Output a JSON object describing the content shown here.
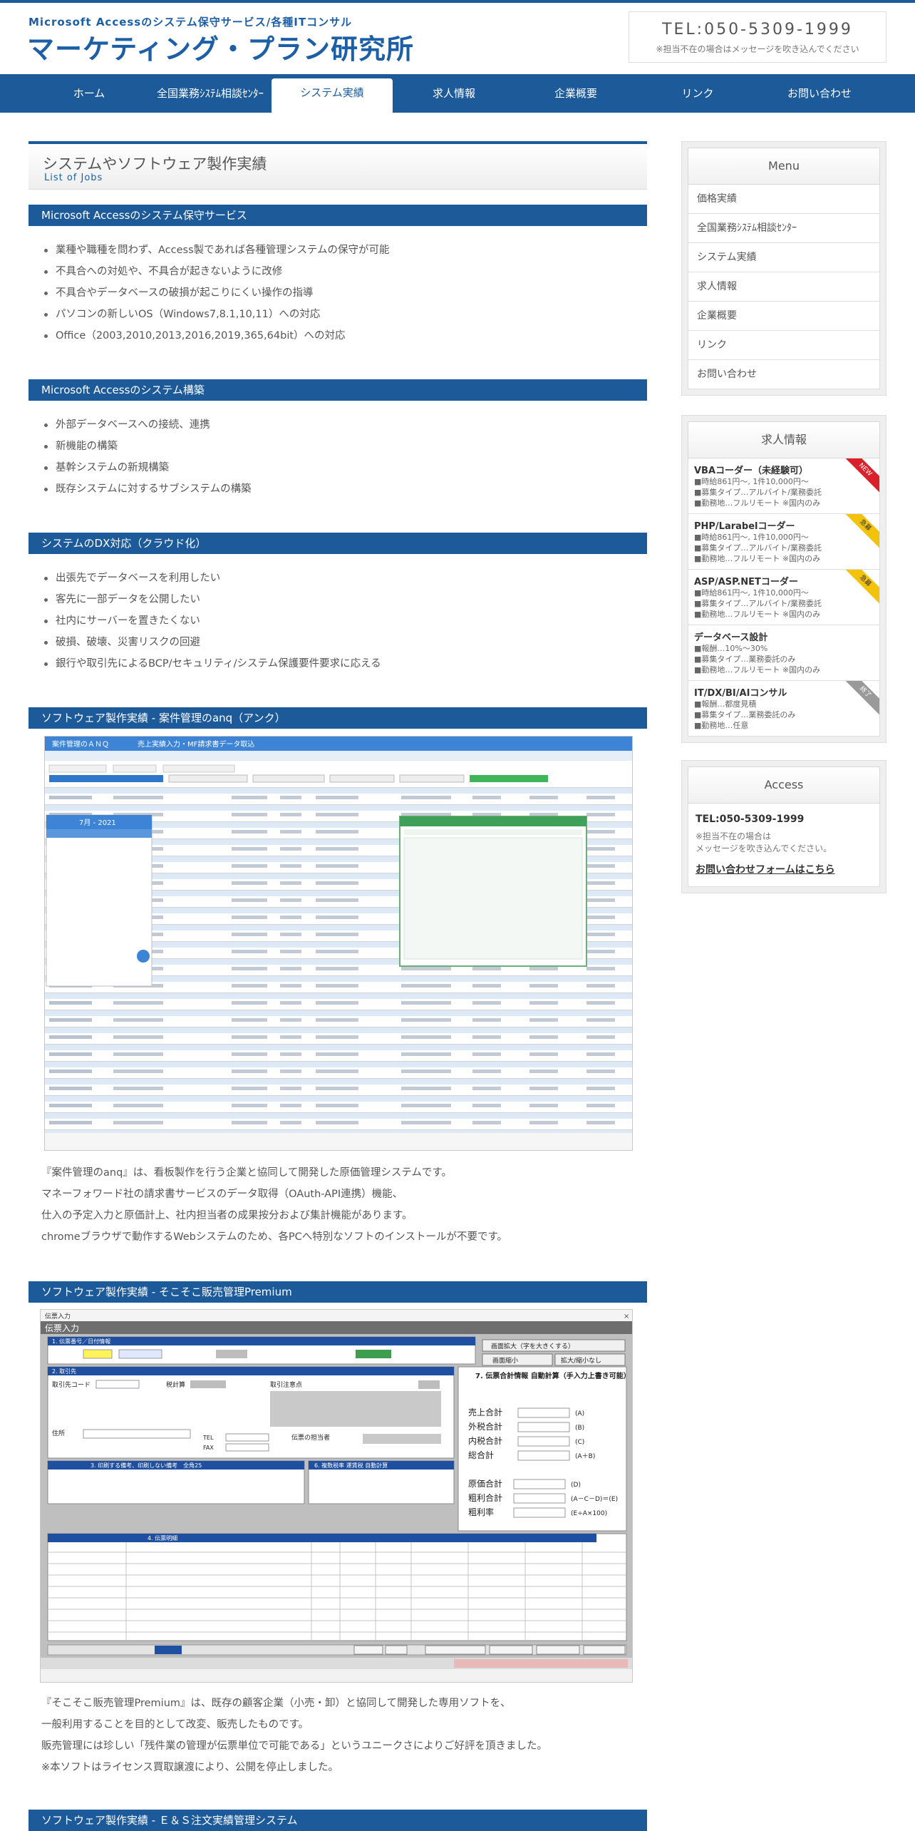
{
  "header": {
    "tagline": "Microsoft Accessのシステム保守サービス/各種ITコンサル",
    "logo": "マーケティング・プラン研究所",
    "tel": "TEL:050-5309-1999",
    "tel_note": "※担当不在の場合はメッセージを吹き込んでください"
  },
  "nav": [
    {
      "label": "ホーム"
    },
    {
      "label": "全国業務ｼｽﾃﾑ相談ｾﾝﾀｰ"
    },
    {
      "label": "システム実績"
    },
    {
      "label": "求人情報"
    },
    {
      "label": "企業概要"
    },
    {
      "label": "リンク"
    },
    {
      "label": "お問い合わせ"
    }
  ],
  "page": {
    "title": "システムやソフトウェア製作実績",
    "subtitle": "List of Jobs"
  },
  "sections": [
    {
      "heading": "Microsoft Accessのシステム保守サービス",
      "items": [
        "業種や職種を問わず、Access製であれば各種管理システムの保守が可能",
        "不具合への対処や、不具合が起きないように改修",
        "不具合やデータベースの破損が起こりにくい操作の指導",
        "パソコンの新しいOS（Windows7,8.1,10,11）への対応",
        "Office（2003,2010,2013,2016,2019,365,64bit）への対応"
      ]
    },
    {
      "heading": "Microsoft Accessのシステム構築",
      "items": [
        "外部データベースへの接続、連携",
        "新機能の構築",
        "基幹システムの新規構築",
        "既存システムに対するサブシステムの構築"
      ]
    },
    {
      "heading": "システムのDX対応（クラウド化）",
      "items": [
        "出張先でデータベースを利用したい",
        "客先に一部データを公開したい",
        "社内にサーバーを置きたくない",
        "破損、破壊、災害リスクの回避",
        "銀行や取引先によるBCP/セキュリティ/システム保護要件要求に応える"
      ]
    },
    {
      "heading": "ソフトウェア製作実績 - 案件管理のanq（アンク）",
      "paragraphs": [
        "『案件管理のanq』は、看板製作を行う企業と協同して開発した原価管理システムです。",
        "マネーフォワード社の請求書サービスのデータ取得（OAuth-API連携）機能、",
        "仕入の予定入力と原価計上、社内担当者の成果按分および集計機能があります。",
        "chromeブラウザで動作するWebシステムのため、各PCへ特別なソフトのインストールが不要です。"
      ]
    },
    {
      "heading": "ソフトウェア製作実績 - そこそこ販売管理Premium",
      "paragraphs": [
        "『そこそこ販売管理Premium』は、既存の顧客企業（小売・卸）と協同して開発した専用ソフトを、",
        "一般利用することを目的として改変、販売したものです。",
        "販売管理には珍しい「残件業の管理が伝票単位で可能である」というユニークさによりご好評を頂きました。",
        "※本ソフトはライセンス買取譲渡により、公開を停止しました。"
      ]
    },
    {
      "heading": "ソフトウェア製作実績 - Ｅ＆Ｓ注文実績管理システム"
    }
  ],
  "anq_shot": {
    "title": "案件管理のＡＮＱ",
    "subtitle": "売上実績入力・MF請求書データ取込",
    "calendar_month": "7月 - 2021"
  },
  "sokoso_shot": {
    "window_title": "伝票入力",
    "header": "伝票入力",
    "panel1": "1. 伝票番号／日付情報",
    "panel2": "2. 取引先",
    "panel3": "3. 印刷する備考、印刷しない備考　全角25",
    "panel6": "6. 複数税率 運賃税 自動計算",
    "panel7": "7. 伝票合計情報 自動計算（手入力上書き可能）",
    "panel4": "4. 伝票明細",
    "totals": [
      {
        "label": "売上合計",
        "code": "(A)"
      },
      {
        "label": "外税合計",
        "code": "(B)"
      },
      {
        "label": "内税合計",
        "code": "(C)"
      },
      {
        "label": "総合計",
        "code": "(A＋B)"
      }
    ],
    "profit": [
      {
        "label": "原価合計",
        "code": "(D)"
      },
      {
        "label": "粗利合計",
        "code": "(A－C－D)＝(E)"
      },
      {
        "label": "粗利率",
        "code": "(E÷A×100)"
      }
    ],
    "buttons": [
      "画面拡大（字を大きくする）",
      "画面縮小",
      "拡大/縮小なし"
    ],
    "fields": [
      "取引先コード",
      "税計算",
      "取引注意点",
      "住所",
      "TEL",
      "FAX",
      "伝票の担当者"
    ]
  },
  "sidebar": {
    "menu_title": "Menu",
    "menu": [
      "価格実績",
      "全国業務ｼｽﾃﾑ相談ｾﾝﾀｰ",
      "システム実績",
      "求人情報",
      "企業概要",
      "リンク",
      "お問い合わせ"
    ],
    "jobs_title": "求人情報",
    "jobs": [
      {
        "title": "VBAコーダー（未経験可）",
        "lines": [
          "■時給861円～, 1件10,000円～",
          "■募集タイプ…アルバイト/業務委託",
          "■勤務地…フルリモート ※国内のみ"
        ],
        "badge": "NEW",
        "color": "#d9202b"
      },
      {
        "title": "PHP/Larabelコーダー",
        "lines": [
          "■時給861円～, 1件10,000円～",
          "■募集タイプ…アルバイト/業務委託",
          "■勤務地…フルリモート ※国内のみ"
        ],
        "badge": "急募",
        "color": "#f3c20b"
      },
      {
        "title": "ASP/ASP.NETコーダー",
        "lines": [
          "■時給861円～, 1件10,000円～",
          "■募集タイプ…アルバイト/業務委託",
          "■勤務地…フルリモート ※国内のみ"
        ],
        "badge": "急募",
        "color": "#f3c20b"
      },
      {
        "title": "データベース設計",
        "lines": [
          "■報酬…10%～30%",
          "■募集タイプ…業務委託のみ",
          "■勤務地…フルリモート ※国内のみ"
        ],
        "badge": "",
        "color": ""
      },
      {
        "title": "IT/DX/BI/AIコンサル",
        "lines": [
          "■報酬…都度見積",
          "■募集タイプ…業務委託のみ",
          "■勤務地…任意"
        ],
        "badge": "終了",
        "color": "#9a9a9a"
      }
    ],
    "access_title": "Access",
    "access_tel": "TEL:050-5309-1999",
    "access_note1": "※担当不在の場合は",
    "access_note2": "メッセージを吹き込んでください。",
    "access_link": "お問い合わせフォームはこちら"
  }
}
